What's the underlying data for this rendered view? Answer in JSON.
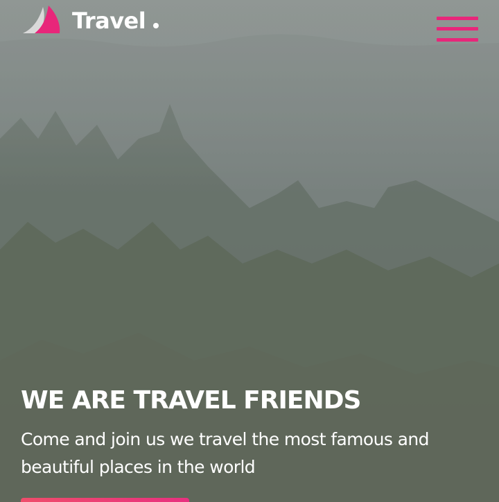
{
  "header": {
    "brand_name": "Travel",
    "logo_icon": "sail-logo-icon",
    "menu_icon": "hamburger-menu-icon"
  },
  "hero": {
    "title": "WE ARE TRAVEL FRIENDS",
    "subtitle": "Come and join us we travel the most famous and beautiful places in the world"
  },
  "colors": {
    "accent": "#e8267a",
    "accent_gradient_start": "#ef4d6b",
    "text": "#ffffff"
  }
}
